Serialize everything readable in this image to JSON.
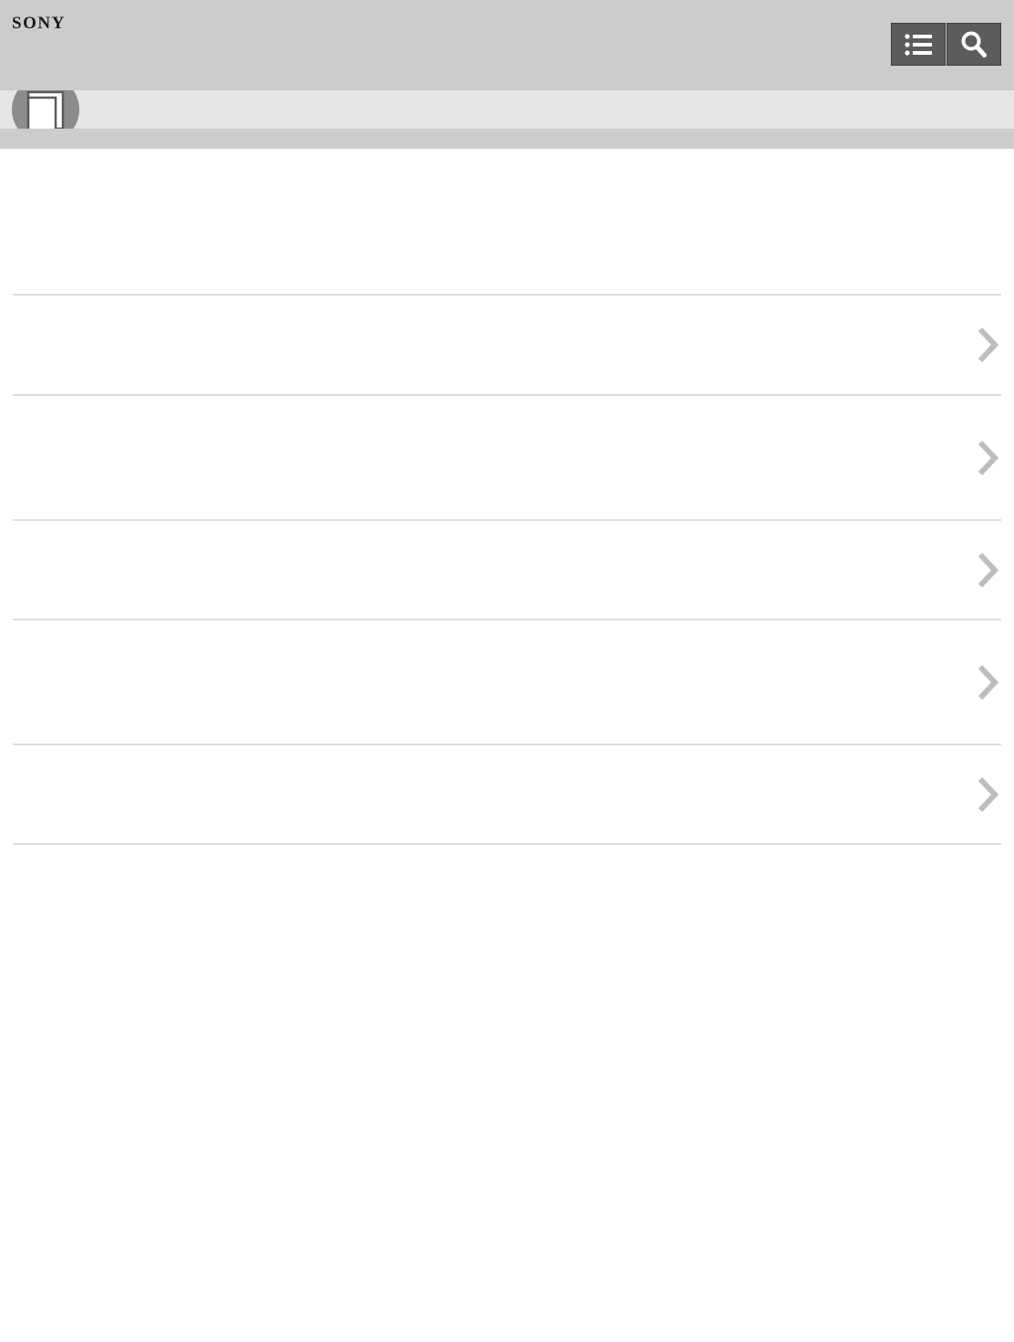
{
  "header": {
    "brand": "SONY",
    "menu_button_icon": "list-icon",
    "search_button_icon": "search-icon"
  },
  "subheader": {
    "category_icon": "book-icon"
  },
  "colors": {
    "header_bg": "#cccccc",
    "subbar_bg": "#e6e6e6",
    "button_bg": "#5c5c5c",
    "divider": "#dddddd",
    "chevron": "#bdbdbd"
  },
  "list": {
    "items": [
      {
        "label": "",
        "icon": "chevron-right-icon"
      },
      {
        "label": "",
        "icon": "chevron-right-icon"
      },
      {
        "label": "",
        "icon": "chevron-right-icon"
      },
      {
        "label": "",
        "icon": "chevron-right-icon"
      },
      {
        "label": "",
        "icon": "chevron-right-icon"
      }
    ]
  }
}
